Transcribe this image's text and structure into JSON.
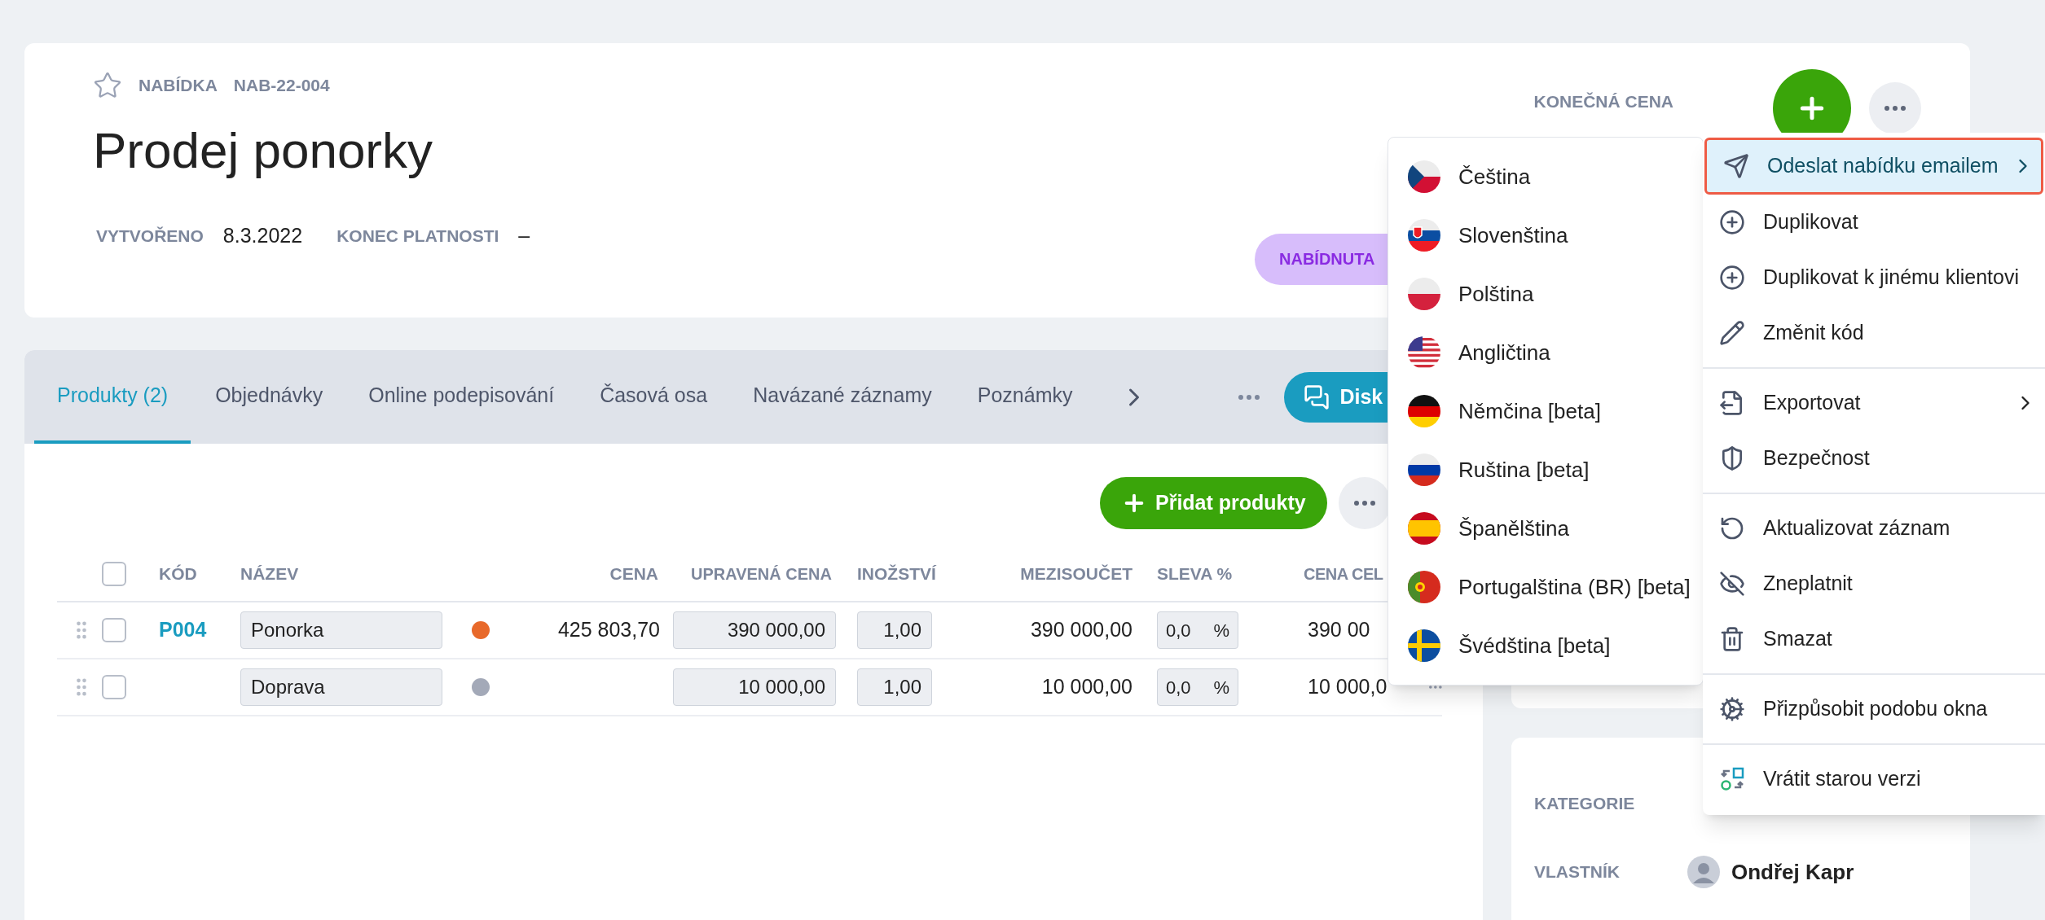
{
  "header": {
    "favorite": false,
    "type_label": "NABÍDKA",
    "code": "NAB-22-004",
    "title": "Prodej ponorky",
    "meta": [
      {
        "label": "VYTVOŘENO",
        "value": "8.3.2022"
      },
      {
        "label": "KONEC PLATNOSTI",
        "value": "–"
      }
    ],
    "status_badge": "NABÍDNUTA",
    "price_label": "KONEČNÁ CENA"
  },
  "tabs": [
    {
      "label": "Produkty (2)",
      "selected": true
    },
    {
      "label": "Objednávky",
      "selected": false
    },
    {
      "label": "Online podepisování",
      "selected": false
    },
    {
      "label": "Časová osa",
      "selected": false
    },
    {
      "label": "Navázané záznamy",
      "selected": false
    },
    {
      "label": "Poznámky",
      "selected": false
    }
  ],
  "discussion_button": "Disk",
  "products": {
    "add_button": "Přidat produkty",
    "select_all_checked": false,
    "columns": [
      "KÓD",
      "NÁZEV",
      "CENA",
      "UPRAVENÁ CENA",
      "INOŽSTVÍ",
      "MEZISOUČET",
      "SLEVA %",
      "CENA CEL"
    ],
    "rows": [
      {
        "code": "P004",
        "name": "Ponorka",
        "color": "#e8692a",
        "price": "425 803,70",
        "adjusted_price": "390 000,00",
        "quantity": "1,00",
        "subtotal": "390 000,00",
        "discount": "0,0",
        "discount_unit": "%",
        "total": "390 00",
        "checked": false
      },
      {
        "code": "",
        "name": "Doprava",
        "color": "#a3a9b8",
        "price": "",
        "adjusted_price": "10 000,00",
        "quantity": "1,00",
        "subtotal": "10 000,00",
        "discount": "0,0",
        "discount_unit": "%",
        "total": "10 000,0",
        "row_menu": true,
        "checked": false
      }
    ]
  },
  "side": [
    {
      "label": "KATEGORIE"
    },
    {
      "label": "VLASTNÍK",
      "value": "Ondřej Kapr"
    }
  ],
  "language_menu": [
    {
      "label": "Čeština",
      "kind": "cz"
    },
    {
      "label": "Slovenština",
      "kind": "sk"
    },
    {
      "label": "Polština",
      "kind": "pl"
    },
    {
      "label": "Angličtina",
      "kind": "us"
    },
    {
      "label": "Němčina [beta]",
      "kind": "de"
    },
    {
      "label": "Ruština [beta]",
      "kind": "ru"
    },
    {
      "label": "Španělština",
      "kind": "es"
    },
    {
      "label": "Portugalština (BR) [beta]",
      "kind": "pt"
    },
    {
      "label": "Švédština [beta]",
      "kind": "se"
    }
  ],
  "actions_menu": [
    {
      "label": "Odeslat nabídku emailem",
      "kind": "send",
      "selected": true,
      "submenu": true,
      "divider_before": false
    },
    {
      "label": "Duplikovat",
      "kind": "duplicate",
      "selected": false,
      "submenu": false,
      "divider_before": false
    },
    {
      "label": "Duplikovat k jinému klientovi",
      "kind": "duplicate",
      "selected": false,
      "submenu": false,
      "divider_before": false
    },
    {
      "label": "Změnit kód",
      "kind": "edit",
      "selected": false,
      "submenu": false,
      "divider_before": false
    },
    {
      "label": "Exportovat",
      "kind": "export",
      "selected": false,
      "submenu": true,
      "divider_before": true
    },
    {
      "label": "Bezpečnost",
      "kind": "security",
      "selected": false,
      "submenu": false,
      "divider_before": false
    },
    {
      "label": "Aktualizovat záznam",
      "kind": "refresh",
      "selected": false,
      "submenu": false,
      "divider_before": true
    },
    {
      "label": "Zneplatnit",
      "kind": "invalidate",
      "selected": false,
      "submenu": false,
      "divider_before": false
    },
    {
      "label": "Smazat",
      "kind": "delete",
      "selected": false,
      "submenu": false,
      "divider_before": false
    },
    {
      "label": "Přizpůsobit podobu okna",
      "kind": "customize",
      "selected": false,
      "submenu": false,
      "divider_before": true
    },
    {
      "label": "Vrátit starou verzi",
      "kind": "revert",
      "selected": false,
      "submenu": false,
      "divider_before": true
    }
  ]
}
